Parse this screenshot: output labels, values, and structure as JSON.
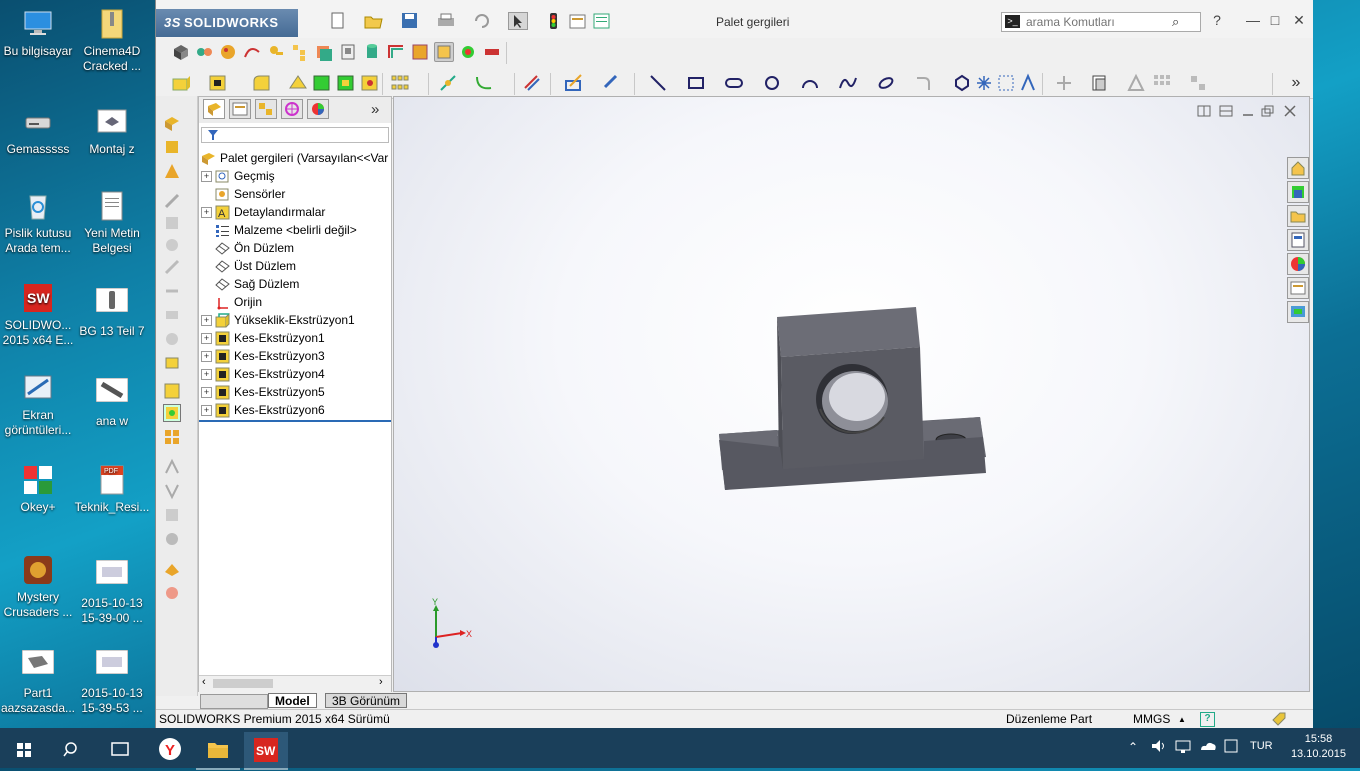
{
  "desktop": {
    "icons": [
      {
        "label": "Bu bilgisayar"
      },
      {
        "label": "Cinema4D Cracked ..."
      },
      {
        "label": "Gemasssss"
      },
      {
        "label": "Montaj z"
      },
      {
        "label": "Pislik kutusu Arada tem..."
      },
      {
        "label": "Yeni Metin Belgesi"
      },
      {
        "label": "SOLIDWO... 2015 x64 E..."
      },
      {
        "label": "BG 13 Teil 7"
      },
      {
        "label": "Ekran görüntüleri..."
      },
      {
        "label": "ana w"
      },
      {
        "label": "Okey+"
      },
      {
        "label": "Teknik_Resi..."
      },
      {
        "label": "Mystery Crusaders ..."
      },
      {
        "label": "2015-10-13 15-39-00 ..."
      },
      {
        "label": "Part1 aazsazasda..."
      },
      {
        "label": "2015-10-13 15-39-53 ..."
      }
    ]
  },
  "window": {
    "app_logo": "SOLIDWORKS",
    "app_logo_prefix": "3S",
    "title": "Palet gergileri",
    "search_placeholder": "arama Komutları",
    "help_icon": "?",
    "min_icon": "—",
    "max_icon": "□",
    "close_icon": "✕"
  },
  "tree": {
    "collapse_icon": "»",
    "root": "Palet gergileri  (Varsayılan<<Var",
    "nodes": [
      {
        "label": "Geçmiş",
        "expandable": true,
        "icon": "history-icon"
      },
      {
        "label": "Sensörler",
        "expandable": false,
        "icon": "sensor-icon"
      },
      {
        "label": "Detaylandırmalar",
        "expandable": true,
        "icon": "annotations-icon"
      },
      {
        "label": "Malzeme <belirli değil>",
        "expandable": false,
        "icon": "material-icon"
      },
      {
        "label": "Ön Düzlem",
        "expandable": false,
        "icon": "plane-icon"
      },
      {
        "label": "Üst Düzlem",
        "expandable": false,
        "icon": "plane-icon"
      },
      {
        "label": "Sağ Düzlem",
        "expandable": false,
        "icon": "plane-icon"
      },
      {
        "label": "Orijin",
        "expandable": false,
        "icon": "origin-icon"
      },
      {
        "label": "Yükseklik-Ekstrüzyon1",
        "expandable": true,
        "icon": "extrude-icon"
      },
      {
        "label": "Kes-Ekstrüzyon1",
        "expandable": true,
        "icon": "cut-extrude-icon"
      },
      {
        "label": "Kes-Ekstrüzyon3",
        "expandable": true,
        "icon": "cut-extrude-icon"
      },
      {
        "label": "Kes-Ekstrüzyon4",
        "expandable": true,
        "icon": "cut-extrude-icon"
      },
      {
        "label": "Kes-Ekstrüzyon5",
        "expandable": true,
        "icon": "cut-extrude-icon"
      },
      {
        "label": "Kes-Ekstrüzyon6",
        "expandable": true,
        "icon": "cut-extrude-icon"
      }
    ]
  },
  "bottom_tabs": {
    "model": "Model",
    "view3d": "3B Görünüm"
  },
  "triad": {
    "y": "Y",
    "x": "X"
  },
  "status": {
    "version": "SOLIDWORKS Premium 2015 x64 Sürümü",
    "mode": "Düzenleme Part",
    "units": "MMGS",
    "units_arrow": "▲"
  },
  "taskbar": {
    "lang": "TUR",
    "time": "15:58",
    "date": "13.10.2015",
    "sw_badge": "SW",
    "yandex_letter": "Y"
  },
  "colors": {
    "accent": "#1e6fd0",
    "part": "#5f6069",
    "tree_select_line": "#2a6ab5"
  }
}
